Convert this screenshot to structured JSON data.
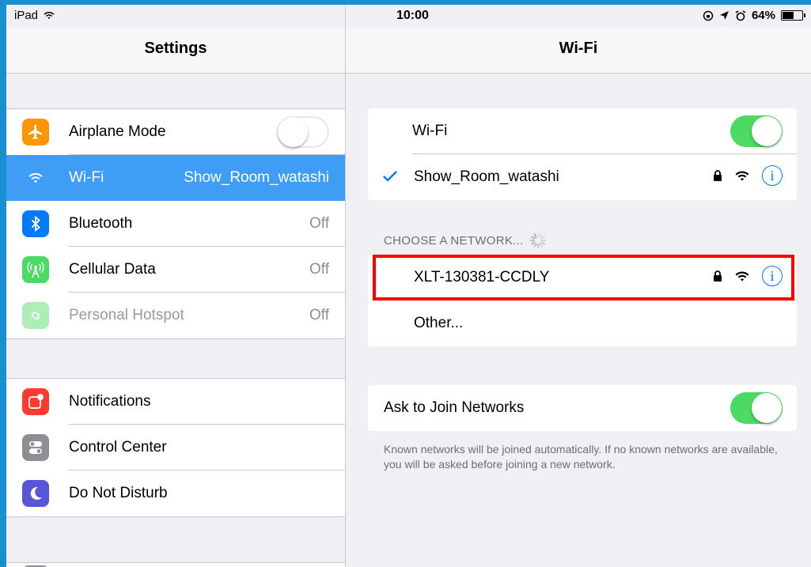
{
  "status_bar": {
    "carrier": "iPad",
    "time": "10:00",
    "battery": "64%",
    "battery_level": 0.64
  },
  "settings": {
    "title": "Settings",
    "group1": [
      {
        "label": "Airplane Mode",
        "icon": "airplane-icon",
        "color": "#ff9500",
        "toggle": "off"
      },
      {
        "label": "Wi-Fi",
        "value": "Show_Room_watashi",
        "icon": "wifi-icon",
        "color": "#3f9df6",
        "selected": true
      },
      {
        "label": "Bluetooth",
        "value": "Off",
        "icon": "bluetooth-icon",
        "color": "#007aff"
      },
      {
        "label": "Cellular Data",
        "value": "Off",
        "icon": "cellular-icon",
        "color": "#4cd964"
      },
      {
        "label": "Personal Hotspot",
        "value": "Off",
        "icon": "hotspot-icon",
        "color": "#4cd964",
        "disabled": true
      }
    ],
    "group2": [
      {
        "label": "Notifications",
        "icon": "notifications-icon",
        "color": "#ff3b30"
      },
      {
        "label": "Control Center",
        "icon": "control-center-icon",
        "color": "#8e8e93"
      },
      {
        "label": "Do Not Disturb",
        "icon": "moon-icon",
        "color": "#5856d6"
      }
    ]
  },
  "wifi": {
    "title": "Wi-Fi",
    "toggle_label": "Wi-Fi",
    "toggle_state": "on",
    "connected_network": "Show_Room_watashi",
    "choose_header": "CHOOSE A NETWORK...",
    "networks": [
      {
        "name": "XLT-130381-CCDLY",
        "secured": true
      },
      {
        "name": "Other..."
      }
    ],
    "ask_to_join_label": "Ask to Join Networks",
    "ask_to_join_state": "on",
    "footer_note": "Known networks will be joined automatically. If no known networks are available, you will be asked before joining a new network.",
    "highlight_color": "#ff0000"
  }
}
